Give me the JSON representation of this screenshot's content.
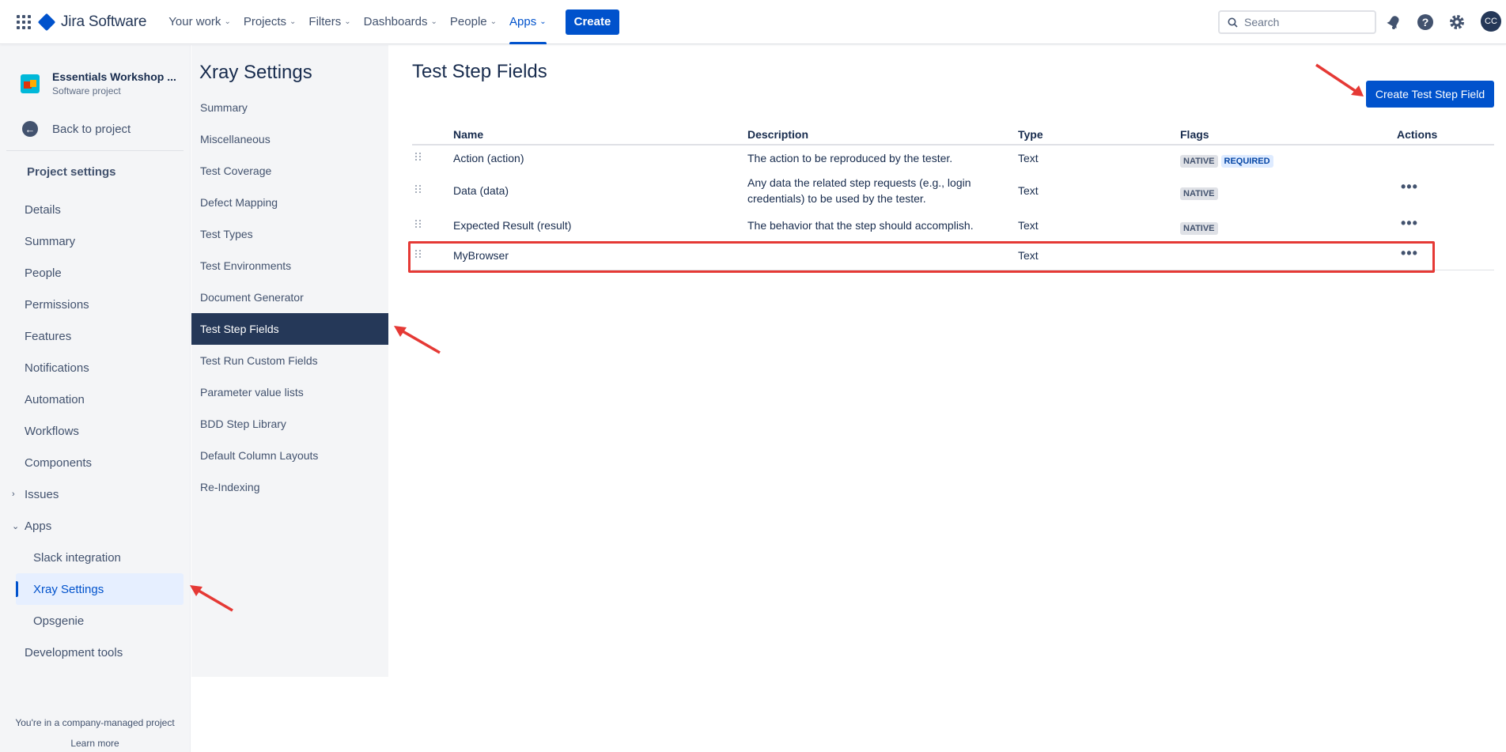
{
  "topnav": {
    "product": "Jira Software",
    "items": [
      {
        "label": "Your work"
      },
      {
        "label": "Projects"
      },
      {
        "label": "Filters"
      },
      {
        "label": "Dashboards"
      },
      {
        "label": "People"
      },
      {
        "label": "Apps"
      }
    ],
    "create_label": "Create",
    "search_placeholder": "Search",
    "avatar_initials": "CC"
  },
  "sidebar": {
    "project_name": "Essentials Workshop ...",
    "project_type": "Software project",
    "back_label": "Back to project",
    "section_title": "Project settings",
    "items": [
      {
        "label": "Details"
      },
      {
        "label": "Summary"
      },
      {
        "label": "People"
      },
      {
        "label": "Permissions"
      },
      {
        "label": "Features"
      },
      {
        "label": "Notifications"
      },
      {
        "label": "Automation"
      },
      {
        "label": "Workflows"
      },
      {
        "label": "Components"
      },
      {
        "label": "Issues"
      },
      {
        "label": "Apps"
      },
      {
        "label": "Slack integration"
      },
      {
        "label": "Xray Settings"
      },
      {
        "label": "Opsgenie"
      },
      {
        "label": "Development tools"
      }
    ],
    "footer_text": "You're in a company-managed project",
    "footer_link": "Learn more"
  },
  "xray": {
    "title": "Xray Settings",
    "items": [
      {
        "label": "Summary"
      },
      {
        "label": "Miscellaneous"
      },
      {
        "label": "Test Coverage"
      },
      {
        "label": "Defect Mapping"
      },
      {
        "label": "Test Types"
      },
      {
        "label": "Test Environments"
      },
      {
        "label": "Document Generator"
      },
      {
        "label": "Test Step Fields"
      },
      {
        "label": "Test Run Custom Fields"
      },
      {
        "label": "Parameter value lists"
      },
      {
        "label": "BDD Step Library"
      },
      {
        "label": "Default Column Layouts"
      },
      {
        "label": "Re-Indexing"
      }
    ]
  },
  "main": {
    "title": "Test Step Fields",
    "create_button": "Create Test Step Field",
    "columns": {
      "name": "Name",
      "description": "Description",
      "type": "Type",
      "flags": "Flags",
      "actions": "Actions"
    },
    "rows": [
      {
        "name": "Action (action)",
        "description": "The action to be reproduced by the tester.",
        "type": "Text",
        "flag1": "NATIVE",
        "flag2": "REQUIRED"
      },
      {
        "name": "Data (data)",
        "description": "Any data the related step requests (e.g., login credentials) to be used by the tester.",
        "type": "Text",
        "flag1": "NATIVE"
      },
      {
        "name": "Expected Result (result)",
        "description": "The behavior that the step should accomplish.",
        "type": "Text",
        "flag1": "NATIVE"
      },
      {
        "name": "MyBrowser",
        "description": "",
        "type": "Text"
      }
    ]
  },
  "colors": {
    "brand": "#0052cc",
    "active_sidebar": "#253858",
    "annotation": "#e53935"
  }
}
